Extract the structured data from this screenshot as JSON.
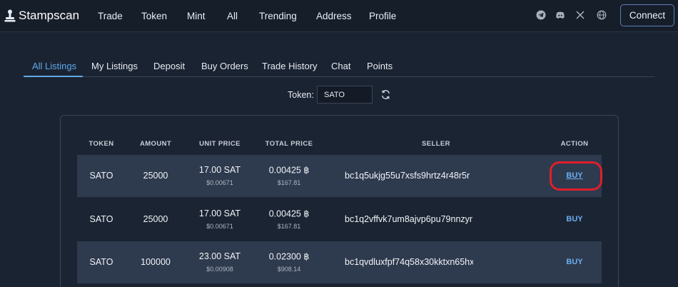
{
  "brand": {
    "name": "Stampscan",
    "icon": "stamp-logo-icon"
  },
  "nav": [
    "Trade",
    "Token",
    "Mint",
    "All",
    "Trending",
    "Address",
    "Profile"
  ],
  "social_icons": [
    "telegram-icon",
    "discord-icon",
    "x-icon",
    "globe-icon"
  ],
  "connect_label": "Connect",
  "tabs": [
    "All Listings",
    "My Listings",
    "Deposit",
    "Buy Orders",
    "Trade History",
    "Chat",
    "Points"
  ],
  "active_tab": "All Listings",
  "filter": {
    "label": "Token:",
    "value": "SATO"
  },
  "table": {
    "headers": [
      "TOKEN",
      "AMOUNT",
      "UNIT PRICE",
      "TOTAL PRICE",
      "SELLER",
      "ACTION"
    ],
    "rows": [
      {
        "token": "SATO",
        "amount": "25000",
        "unit_price": "17.00 SAT",
        "unit_usd": "$0.00671",
        "total_price": "0.00425 ฿",
        "total_usd": "$167.81",
        "seller": "bc1q5ukjg55u7xsfs9hrtz4r48r5r",
        "action": "BUY"
      },
      {
        "token": "SATO",
        "amount": "25000",
        "unit_price": "17.00 SAT",
        "unit_usd": "$0.00671",
        "total_price": "0.00425 ฿",
        "total_usd": "$167.81",
        "seller": "bc1q2vffvk7um8ajvp6pu79nnzyr",
        "action": "BUY"
      },
      {
        "token": "SATO",
        "amount": "100000",
        "unit_price": "23.00 SAT",
        "unit_usd": "$0.00908",
        "total_price": "0.02300 ฿",
        "total_usd": "$908.14",
        "seller": "bc1qvdluxfpf74q58x30kktxn65hx",
        "action": "BUY"
      }
    ]
  },
  "colors": {
    "accent": "#5fa8e8",
    "highlight": "#e01f2a",
    "background": "#1a2332"
  }
}
